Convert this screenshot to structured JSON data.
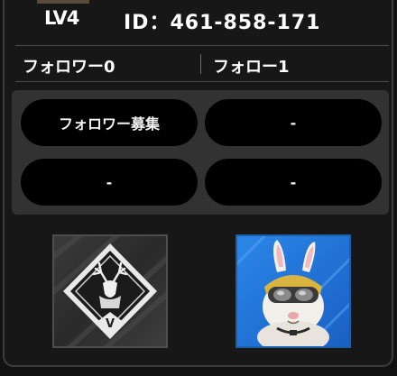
{
  "profile": {
    "level": "LV4",
    "id_text": "ID：461-858-171"
  },
  "follow": {
    "followers": "フォロワー0",
    "following": "フォロー1"
  },
  "slots": [
    {
      "label": "フォロワー募集"
    },
    {
      "label": "-"
    },
    {
      "label": "-"
    },
    {
      "label": "-"
    }
  ],
  "badges": {
    "emblem": {
      "icon": "stag-emblem-icon",
      "mark": "V"
    },
    "avatar": {
      "icon": "rabbit-avatar-icon"
    }
  },
  "colors": {
    "panel_bg": "#171717",
    "slot_area_bg": "#323232",
    "pill_bg": "#000000",
    "avatar_bg": "#1f74d6"
  }
}
